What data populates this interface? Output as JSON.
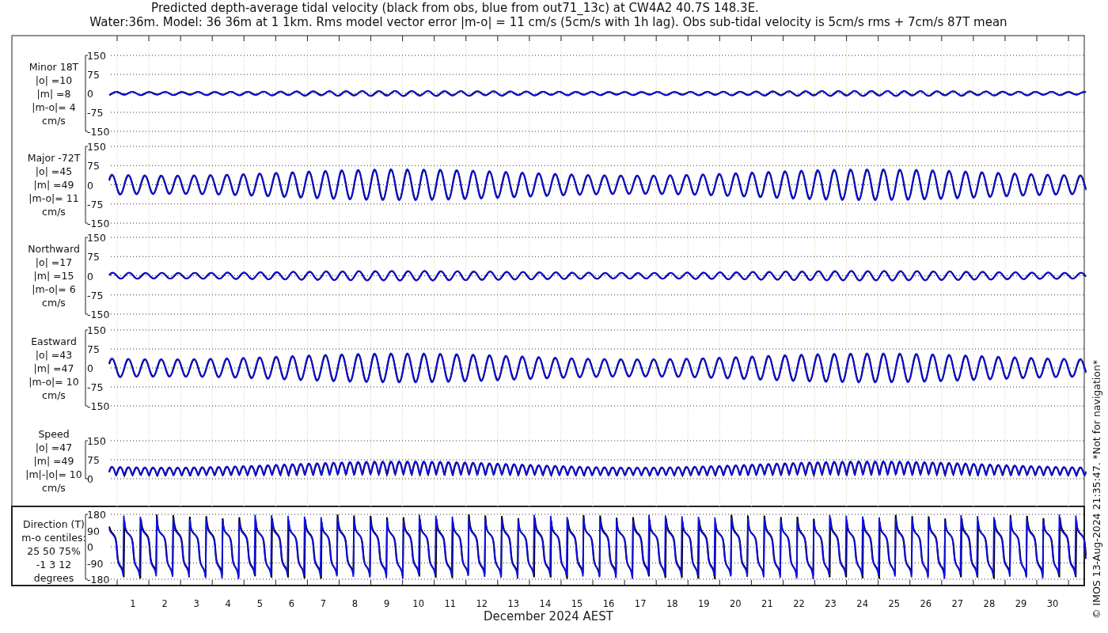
{
  "title_lines": [
    "Predicted depth-average tidal velocity (black from obs, blue from out71_13c) at CW4A2 40.7S 148.3E.",
    "Water:36m. Model: 36 36m at 1 1km. Rms model vector error |m-o| = 11 cm/s (5cm/s with 1h lag). Obs sub-tidal velocity is 5cm/s rms + 7cm/s 87T mean"
  ],
  "panels": [
    {
      "kind": "minor",
      "label_lines": [
        "Minor 18T",
        "|o| =10",
        "|m| =8",
        "|m-o|= 4",
        "cm/s"
      ],
      "yticks": [
        "150",
        "75",
        "0",
        "-75",
        "-150"
      ]
    },
    {
      "kind": "major",
      "label_lines": [
        "Major -72T",
        "|o| =45",
        "|m| =49",
        "|m-o|= 11",
        "cm/s"
      ],
      "yticks": [
        "150",
        "75",
        "0",
        "-75",
        "-150"
      ]
    },
    {
      "kind": "northward",
      "label_lines": [
        "Northward",
        "|o| =17",
        "|m| =15",
        "|m-o|= 6",
        "cm/s"
      ],
      "yticks": [
        "150",
        "75",
        "0",
        "-75",
        "-150"
      ]
    },
    {
      "kind": "eastward",
      "label_lines": [
        "Eastward",
        "|o| =43",
        "|m| =47",
        "|m-o|= 10",
        "cm/s"
      ],
      "yticks": [
        "150",
        "75",
        "0",
        "-75",
        "-150"
      ]
    },
    {
      "kind": "speed",
      "label_lines": [
        "Speed",
        "|o| =47",
        "|m| =49",
        "|m|-|o|= 10",
        "cm/s"
      ],
      "yticks": [
        "150",
        "75",
        "0"
      ]
    },
    {
      "kind": "direction",
      "label_lines": [
        "Direction (T)",
        "m-o centiles:",
        "25  50  75%",
        "-1   3  12",
        "degrees"
      ],
      "yticks": [
        "180",
        "90",
        "0",
        "-90",
        "-180"
      ]
    }
  ],
  "xticks": [
    "1",
    "2",
    "3",
    "4",
    "5",
    "6",
    "7",
    "8",
    "9",
    "10",
    "11",
    "12",
    "13",
    "14",
    "15",
    "16",
    "17",
    "18",
    "19",
    "20",
    "21",
    "22",
    "23",
    "24",
    "25",
    "26",
    "27",
    "28",
    "29",
    "30"
  ],
  "xlabel": "December 2024 AEST",
  "credit": "© IMOS 13-Aug-2024 21:35:47. *Not for navigation*"
}
